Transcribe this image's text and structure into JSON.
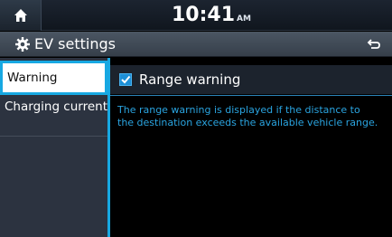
{
  "status_bar": {
    "home_icon": "home-icon",
    "time": "10:41",
    "ampm": "AM"
  },
  "title_bar": {
    "icon": "gear-icon",
    "title": "EV settings",
    "back_icon": "back-arrow-icon"
  },
  "sidebar": {
    "items": [
      {
        "label": "Warning",
        "selected": true
      },
      {
        "label": "Charging current",
        "selected": false
      }
    ]
  },
  "content": {
    "range_warning": {
      "label": "Range warning",
      "checked": true
    },
    "description_lines": [
      "The range warning is displayed if the distance to",
      "the destination exceeds the available vehicle range."
    ]
  },
  "colors": {
    "accent": "#17a8e2",
    "description_text": "#2aa4e0"
  }
}
